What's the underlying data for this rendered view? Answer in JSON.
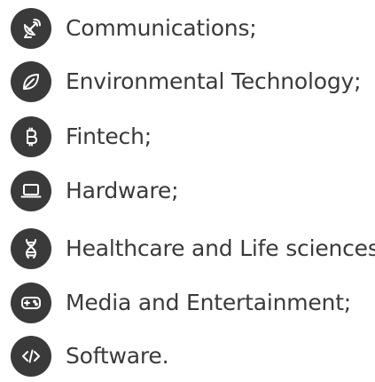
{
  "items": [
    {
      "label": "Communications;",
      "icon": "satellite-dish-icon"
    },
    {
      "label": "Environmental Technology;",
      "icon": "leaf-icon"
    },
    {
      "label": "Fintech;",
      "icon": "bitcoin-icon"
    },
    {
      "label": "Hardware;",
      "icon": "laptop-icon"
    },
    {
      "label": "Healthcare and Life sciences;",
      "icon": "dna-icon"
    },
    {
      "label": "Media and Entertainment;",
      "icon": "gamepad-icon"
    },
    {
      "label": "Software.",
      "icon": "code-icon"
    }
  ],
  "colors": {
    "icon_badge": "#3a3a3a",
    "icon_glyph": "#ffffff",
    "text": "#3a3a3a",
    "background": "#ffffff"
  }
}
